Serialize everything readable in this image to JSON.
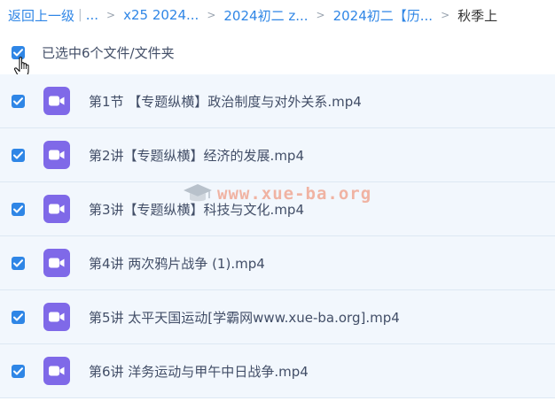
{
  "breadcrumb": {
    "back_label": "返回上一级",
    "ellipsis": "...",
    "separator": ">",
    "items": [
      {
        "label": "x25 2024..."
      },
      {
        "label": "2024初二 z..."
      },
      {
        "label": "2024初二【历..."
      }
    ],
    "current": "秋季上"
  },
  "selection": {
    "label": "已选中6个文件/文件夹",
    "checked": true
  },
  "files": [
    {
      "name": "第1节 【专题纵横】政治制度与对外关系.mp4",
      "icon": "video-icon",
      "checked": true
    },
    {
      "name": "第2讲【专题纵横】经济的发展.mp4",
      "icon": "video-icon",
      "checked": true
    },
    {
      "name": "第3讲【专题纵横】科技与文化.mp4",
      "icon": "video-icon",
      "checked": true
    },
    {
      "name": "第4讲 两次鸦片战争 (1).mp4",
      "icon": "video-icon",
      "checked": true
    },
    {
      "name": "第5讲 太平天国运动[学霸网www.xue-ba.org].mp4",
      "icon": "video-icon",
      "checked": true
    },
    {
      "name": "第6讲 洋务运动与甲午中日战争.mp4",
      "icon": "video-icon",
      "checked": true
    }
  ],
  "watermark": {
    "text": "www.xue-ba.org"
  },
  "colors": {
    "accent": "#2f86e6",
    "row_background": "#f2f7fd",
    "video_icon": "#7f69e8",
    "text": "#424e67"
  }
}
